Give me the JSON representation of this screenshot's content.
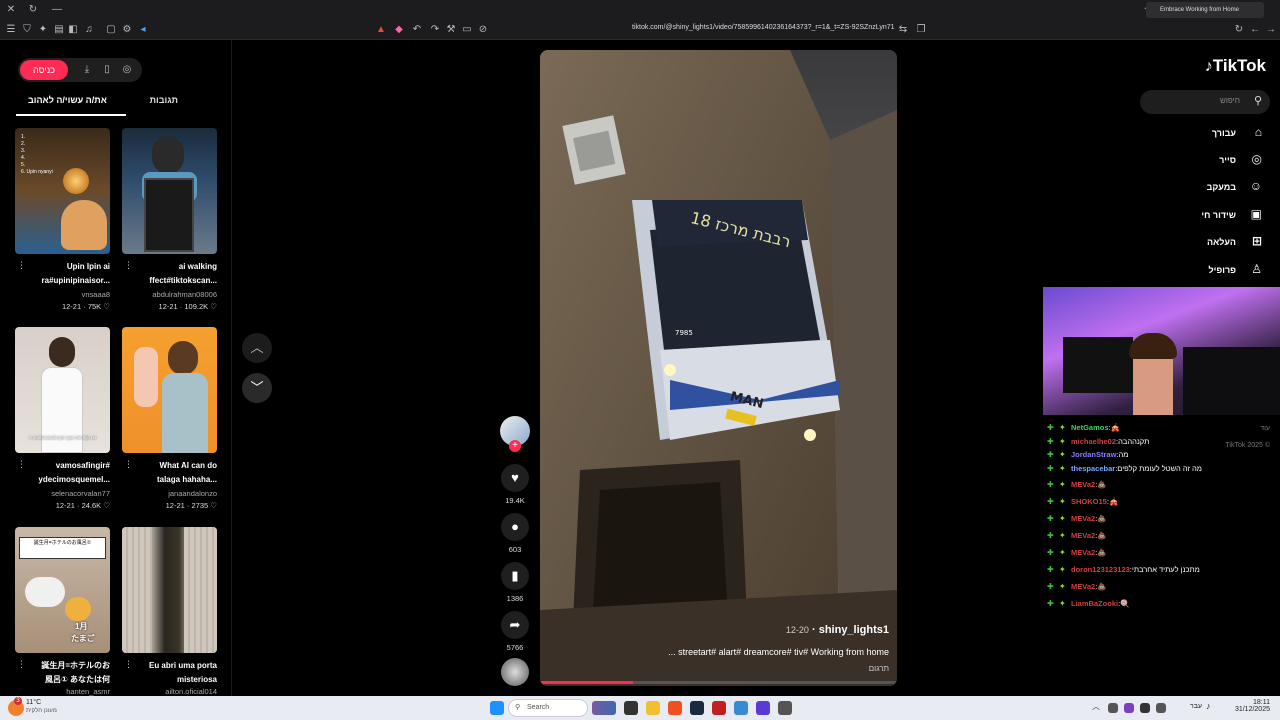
{
  "browser": {
    "tab_title": "Embrace Working from Home",
    "url": "tiktok.com/@shiny_lights1/video/7585996140236164373?_r=1&_t=ZS-92SZnzLyn71"
  },
  "left_panel": {
    "login_label": "כניסה",
    "tab_liked": "את/ה עשוי/ה לאהוב",
    "tab_comments": "תגובות",
    "cards": [
      {
        "title_line1": "Upin Ipin ai",
        "title_line2": "ra#upinipinaisor...",
        "user": "vnsaaa8",
        "date": "12-21",
        "likes": "75K",
        "thumb_text": "1.\n2.\n3.\n4.\n5.\n6. Upin nyanyi"
      },
      {
        "title_line1": "ai walking",
        "title_line2": "ffect#tiktokscan...",
        "user": "abdulrahman08006",
        "date": "12-21",
        "likes": "109.2K",
        "thumb_text": ""
      },
      {
        "title_line1": "vamosafingir#",
        "title_line2": "ydecimosquemel...",
        "user": "selenacorvalan77",
        "date": "12-21",
        "likes": "24.6K",
        "thumb_text": "A continuando por que me dijo no"
      },
      {
        "title_line1": "What AI can do",
        "title_line2": "talaga hahaha...",
        "user": "janaandalonzo",
        "date": "12-21",
        "likes": "2735",
        "thumb_text": ""
      },
      {
        "title_line1": "1月",
        "title_line2": "たまご",
        "user": "",
        "date": "",
        "likes": "",
        "thumb_text": "誕生月=ホテルのお風呂①"
      },
      {
        "title_line1": "",
        "title_line2": "",
        "user": "",
        "date": "",
        "likes": "",
        "thumb_text": ""
      }
    ],
    "bottom_cards": [
      {
        "title_line1": "誕生月=ホテルのお",
        "title_line2": "風呂① あなたは何",
        "user": "hanten_asmr"
      },
      {
        "title_line1": "Eu abri uma porta",
        "title_line2": "misteriosa",
        "user": "ailton.oficial014"
      }
    ]
  },
  "video": {
    "username": "shiny_lights1",
    "date": "12-20",
    "caption": "... streetart# alart# dreamcore# tiv# Working from home",
    "translate": "תרגום",
    "bus_sign": "רבבת מרכז 18",
    "bus_brand": "MAN",
    "bus_number": "7985",
    "progress": 0.26
  },
  "actions": {
    "likes": "19.4K",
    "comments": "603",
    "saves": "1386",
    "shares": "5766"
  },
  "right_nav": {
    "logo": "TikTok",
    "search_placeholder": "חיפוש",
    "items": [
      {
        "label": "עבורך",
        "icon": "home-icon",
        "glyph": "⌂"
      },
      {
        "label": "סייר",
        "icon": "compass-icon",
        "glyph": "◎"
      },
      {
        "label": "במעקב",
        "icon": "following-icon",
        "glyph": "☺"
      },
      {
        "label": "שידור חי",
        "icon": "live-icon",
        "glyph": "▣"
      },
      {
        "label": "העלאה",
        "icon": "upload-icon",
        "glyph": "⊞"
      },
      {
        "label": "פרופיל",
        "icon": "profile-icon",
        "glyph": "♙"
      }
    ],
    "footer_more": "עוד",
    "copyright": "TikTok 2025 ©"
  },
  "chat": [
    {
      "user": "NetGamos",
      "text": "🎪",
      "color": "#3fd070"
    },
    {
      "user": "michaelhe02",
      "text": "תקנההבה",
      "color": "#d04040"
    },
    {
      "user": "JordanStraw",
      "text": "מה",
      "color": "#8a7cff"
    },
    {
      "user": "thespacebar",
      "text": "מה זה השטל לעומת קלפים",
      "color": "#7aa7ff"
    },
    {
      "user": "MEVa2",
      "text": "💩",
      "color": "#d04040"
    },
    {
      "user": "SHOKO15",
      "text": "🎪",
      "color": "#d04040"
    },
    {
      "user": "MEVa2",
      "text": "💩",
      "color": "#d04040"
    },
    {
      "user": "MEVa2",
      "text": "💩",
      "color": "#d04040"
    },
    {
      "user": "MEVa2",
      "text": "💩",
      "color": "#d04040"
    },
    {
      "user": "doron123123123",
      "text": "מתכנן לעתיד אחרבתי",
      "color": "#d04040"
    },
    {
      "user": "MEVa2",
      "text": "💩",
      "color": "#d04040"
    },
    {
      "user": "LiamBaZooki",
      "text": "🍭",
      "color": "#d04040"
    }
  ],
  "taskbar": {
    "weather_temp": "11°C",
    "weather_desc": "מעונן חלקית",
    "weather_alert": "3",
    "search_label": "Search",
    "time": "18:11",
    "date": "31/12/2025",
    "lang": "עבר"
  },
  "colors": {
    "accent": "#fe2c55",
    "bg": "#000000",
    "chat_badge": "#3fbf3f"
  }
}
